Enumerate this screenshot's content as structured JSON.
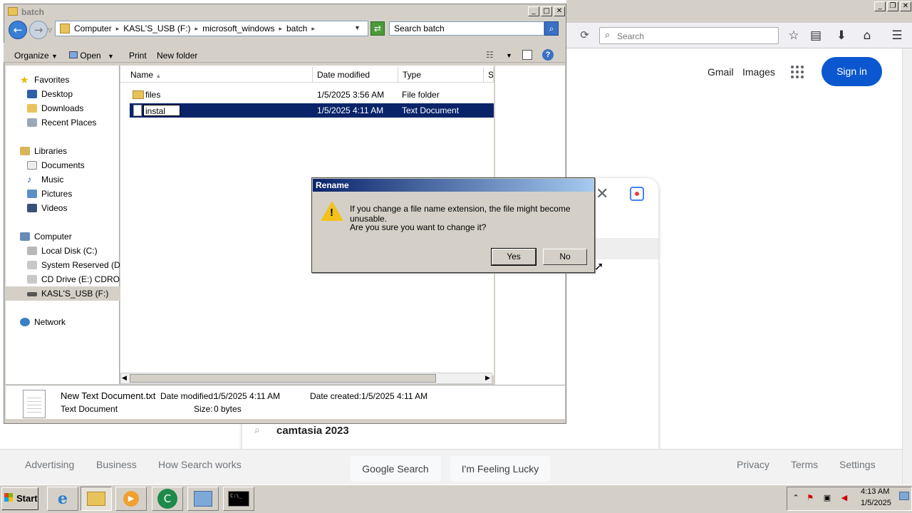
{
  "browser": {
    "search_placeholder": "Search",
    "google": {
      "gmail": "Gmail",
      "images": "Images",
      "signin": "Sign in",
      "suggestion": "camtasia 2023",
      "google_search": "Google Search",
      "feeling_lucky": "I'm Feeling Lucky",
      "footer_left": [
        "Advertising",
        "Business",
        "How Search works"
      ],
      "footer_right": [
        "Privacy",
        "Terms",
        "Settings"
      ]
    }
  },
  "explorer": {
    "title": "batch",
    "breadcrumb": [
      "Computer",
      "KASL'S_USB (F:)",
      "microsoft_windows",
      "batch"
    ],
    "search_placeholder": "Search batch",
    "commands": {
      "organize": "Organize",
      "open": "Open",
      "print": "Print",
      "new_folder": "New folder"
    },
    "nav": {
      "favorites": "Favorites",
      "desktop": "Desktop",
      "downloads": "Downloads",
      "recent": "Recent Places",
      "libraries": "Libraries",
      "documents": "Documents",
      "music": "Music",
      "pictures": "Pictures",
      "videos": "Videos",
      "computer": "Computer",
      "local_disk": "Local Disk (C:)",
      "system_reserved": "System Reserved (D:)",
      "cd_drive": "CD Drive (E:) CDROM",
      "usb": "KASL'S_USB (F:)",
      "network": "Network"
    },
    "columns": {
      "name": "Name",
      "date": "Date modified",
      "type": "Type",
      "size": "Si"
    },
    "files": [
      {
        "name": "files",
        "date": "1/5/2025 3:56 AM",
        "type": "File folder"
      },
      {
        "name": "instal",
        "date": "1/5/2025 4:11 AM",
        "type": "Text Document"
      }
    ],
    "details": {
      "filename": "New Text Document.txt",
      "modified_label": "Date modified:",
      "modified": "1/5/2025 4:11 AM",
      "created_label": "Date created:",
      "created": "1/5/2025 4:11 AM",
      "type": "Text Document",
      "size_label": "Size:",
      "size": "0 bytes"
    }
  },
  "dialog": {
    "title": "Rename",
    "message": "If you change a file name extension, the file might become unusable.",
    "question": "Are you sure you want to change it?",
    "yes": "Yes",
    "no": "No"
  },
  "taskbar": {
    "start": "Start",
    "time": "4:13 AM",
    "date": "1/5/2025"
  }
}
